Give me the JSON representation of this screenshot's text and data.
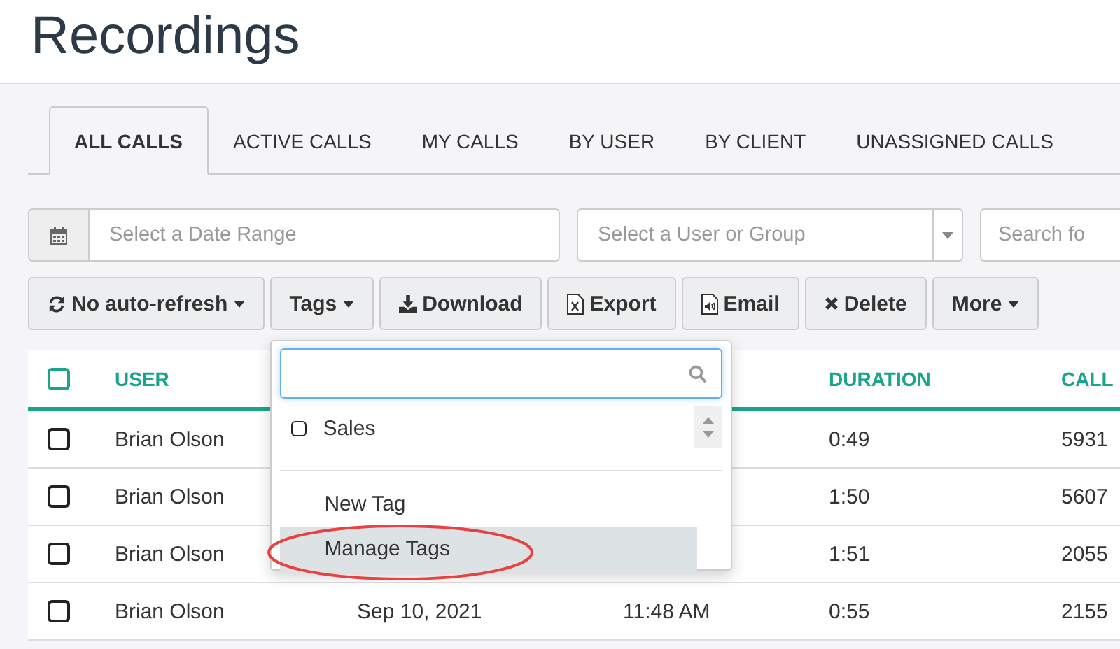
{
  "page": {
    "title": "Recordings"
  },
  "tabs": [
    {
      "label": "ALL CALLS",
      "selected": true
    },
    {
      "label": "ACTIVE CALLS",
      "selected": false
    },
    {
      "label": "MY CALLS",
      "selected": false
    },
    {
      "label": "BY USER",
      "selected": false
    },
    {
      "label": "BY CLIENT",
      "selected": false
    },
    {
      "label": "UNASSIGNED CALLS",
      "selected": false
    }
  ],
  "filters": {
    "date_range": {
      "placeholder": "Select a Date Range"
    },
    "user_group": {
      "placeholder": "Select a User or Group"
    },
    "search": {
      "placeholder": "Search fo"
    }
  },
  "toolbar": [
    {
      "kind": "refresh",
      "label": "No auto-refresh",
      "caret": true
    },
    {
      "kind": "plain",
      "label": "Tags",
      "caret": true
    },
    {
      "kind": "download",
      "label": "Download",
      "caret": false
    },
    {
      "kind": "excel",
      "label": "Export",
      "caret": false
    },
    {
      "kind": "audio",
      "label": "Email",
      "caret": false
    },
    {
      "kind": "delete",
      "label": "Delete",
      "caret": false
    },
    {
      "kind": "plain",
      "label": "More",
      "caret": true
    }
  ],
  "tags_menu": {
    "tags": [
      {
        "label": "Sales",
        "checked": false
      }
    ],
    "actions": [
      {
        "label": "New Tag",
        "selected": false,
        "circled": false
      },
      {
        "label": "Manage Tags",
        "selected": true,
        "circled": true
      }
    ]
  },
  "table": {
    "select_all_checked": false,
    "headers": {
      "user": "USER",
      "duration": "DURATION",
      "call": "CALL"
    },
    "rows": [
      {
        "checked": false,
        "user": "Brian Olson",
        "duration": "0:49",
        "call": "5931"
      },
      {
        "checked": false,
        "user": "Brian Olson",
        "duration": "1:50",
        "call": "5607"
      },
      {
        "checked": false,
        "user": "Brian Olson",
        "duration": "1:51",
        "call": "2055"
      },
      {
        "checked": false,
        "user": "Brian Olson",
        "date": "Sep 10, 2021",
        "time": "11:48 AM",
        "duration": "0:55",
        "call": "2155"
      }
    ]
  }
}
